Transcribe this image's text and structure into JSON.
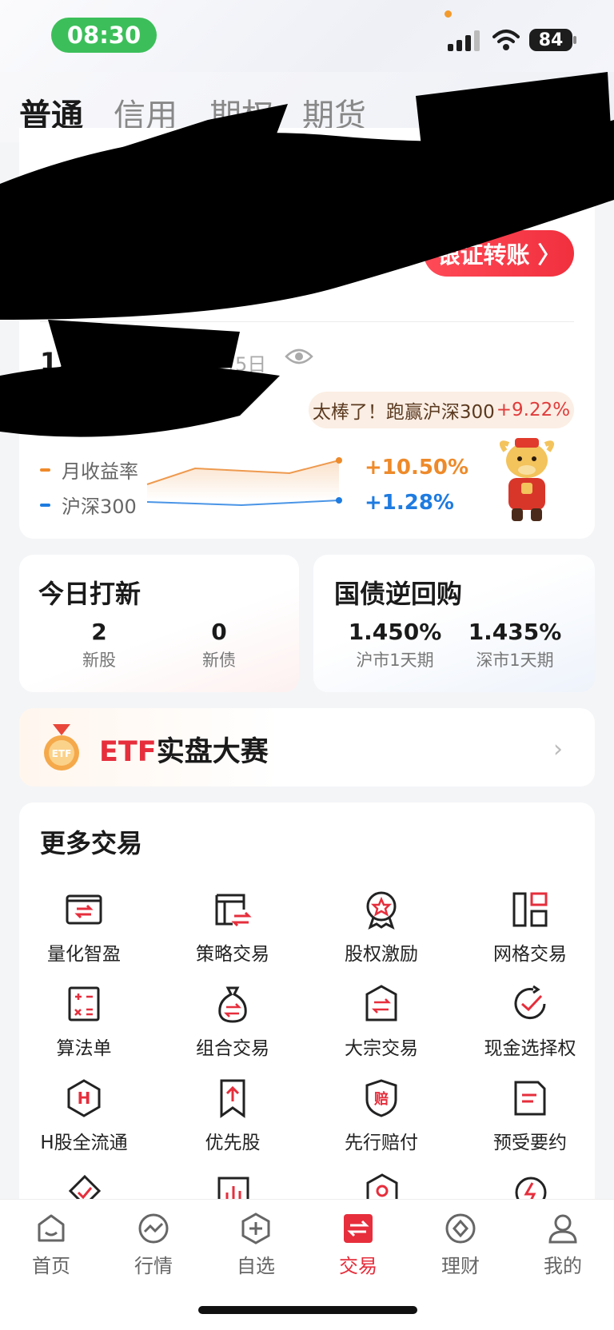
{
  "status_bar": {
    "time": "08:30",
    "battery": "84"
  },
  "tabs": [
    {
      "label": "普通",
      "active": true
    },
    {
      "label": "信用",
      "active": false
    },
    {
      "label": "期权",
      "active": false
    },
    {
      "label": "期货",
      "active": false
    }
  ],
  "account": {
    "transfer_label": "银证转账 〉"
  },
  "monthly": {
    "title": "12月收益",
    "date": "月5日",
    "beat_text": "太棒了！跑赢沪深300",
    "beat_pct": "+9.22%",
    "series": [
      {
        "name": "月收益率",
        "value": "+10.50%",
        "color": "#ee8a2a"
      },
      {
        "name": "沪深300",
        "value": "+1.28%",
        "color": "#1e7be0"
      }
    ]
  },
  "ipo": {
    "title": "今日打新",
    "stats": [
      {
        "value": "2",
        "label": "新股"
      },
      {
        "value": "0",
        "label": "新债"
      }
    ]
  },
  "repo": {
    "title": "国债逆回购",
    "stats": [
      {
        "value": "1.450%",
        "label": "沪市1天期"
      },
      {
        "value": "1.435%",
        "label": "深市1天期"
      }
    ]
  },
  "etf_banner": {
    "prefix": "ETF",
    "title": "实盘大赛",
    "medal_text": "ETF"
  },
  "more_trade": {
    "title": "更多交易",
    "items": [
      {
        "label": "量化智盈",
        "icon": "quant-icon"
      },
      {
        "label": "策略交易",
        "icon": "strategy-icon"
      },
      {
        "label": "股权激励",
        "icon": "equity-incentive-icon"
      },
      {
        "label": "网格交易",
        "icon": "grid-trade-icon"
      },
      {
        "label": "算法单",
        "icon": "algorithm-icon"
      },
      {
        "label": "组合交易",
        "icon": "portfolio-icon"
      },
      {
        "label": "大宗交易",
        "icon": "block-trade-icon"
      },
      {
        "label": "现金选择权",
        "icon": "cash-option-icon"
      },
      {
        "label": "H股全流通",
        "icon": "h-share-icon"
      },
      {
        "label": "优先股",
        "icon": "preferred-share-icon"
      },
      {
        "label": "先行赔付",
        "icon": "compensation-icon"
      },
      {
        "label": "预受要约",
        "icon": "tender-offer-icon"
      }
    ],
    "icon_labels": {
      "compensation": "赔",
      "h_share": "H"
    }
  },
  "bottom_nav": [
    {
      "label": "首页",
      "icon": "home-icon",
      "active": false
    },
    {
      "label": "行情",
      "icon": "market-icon",
      "active": false
    },
    {
      "label": "自选",
      "icon": "watchlist-icon",
      "active": false
    },
    {
      "label": "交易",
      "icon": "trade-icon",
      "active": true
    },
    {
      "label": "理财",
      "icon": "wealth-icon",
      "active": false
    },
    {
      "label": "我的",
      "icon": "profile-icon",
      "active": false
    }
  ],
  "colors": {
    "accent": "#e62e3c",
    "orange": "#ee8a2a",
    "blue": "#1e7be0",
    "status_green": "#3cbf5a"
  }
}
